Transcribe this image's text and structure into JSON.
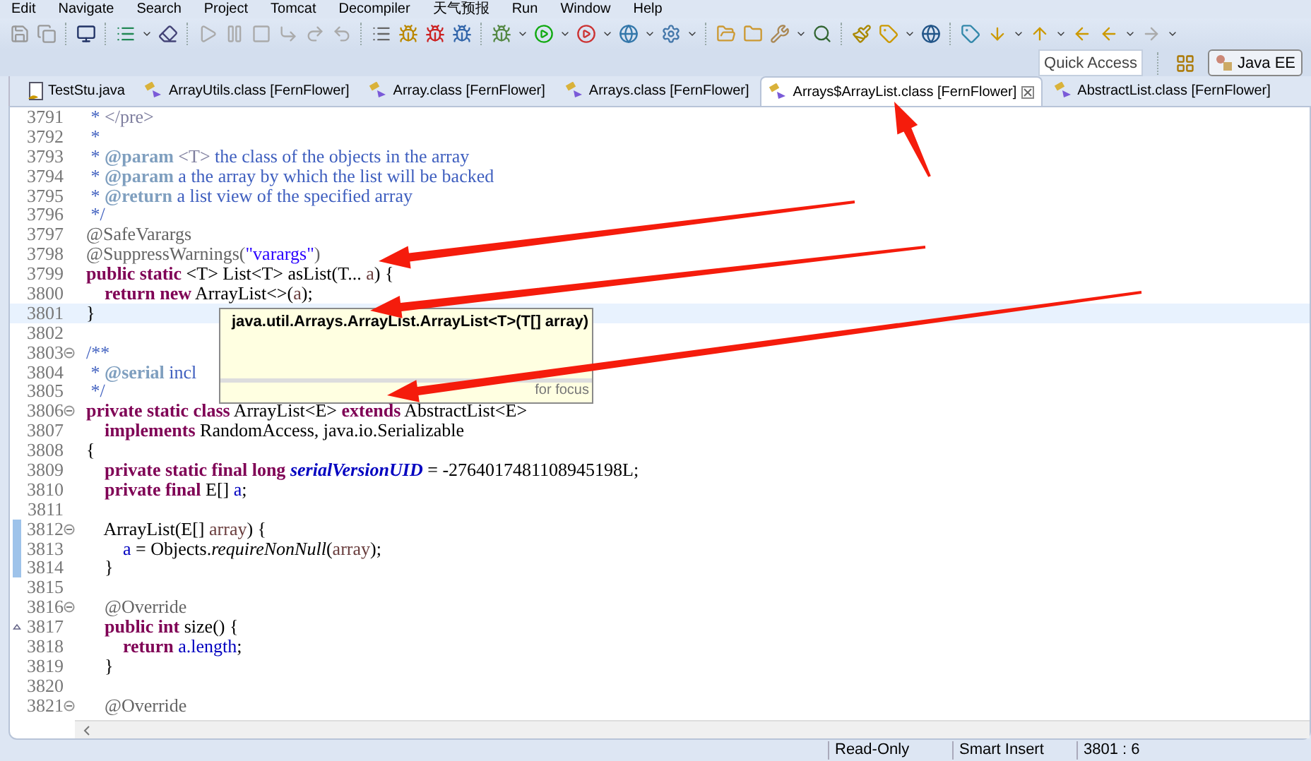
{
  "menu": [
    "Edit",
    "Navigate",
    "Search",
    "Project",
    "Tomcat",
    "Decompiler",
    "天气预报",
    "Run",
    "Window",
    "Help"
  ],
  "quick_access": {
    "placeholder": "Quick Access"
  },
  "perspective": {
    "label": "Java EE",
    "selected": true
  },
  "tabs": [
    {
      "label": "TestStu.java",
      "kind": "java",
      "selected": false
    },
    {
      "label": "ArrayUtils.class [FernFlower]",
      "kind": "class",
      "selected": false
    },
    {
      "label": "Array.class [FernFlower]",
      "kind": "class",
      "selected": false
    },
    {
      "label": "Arrays.class [FernFlower]",
      "kind": "class",
      "selected": false
    },
    {
      "label": "Arrays$ArrayList.class [FernFlower]",
      "kind": "class",
      "selected": true
    },
    {
      "label": "AbstractList.class [FernFlower]",
      "kind": "class",
      "selected": false
    }
  ],
  "lines": [
    {
      "number": "3791",
      "current": false,
      "foldable": false,
      "changed": false,
      "overrides": false,
      "segments": [
        {
          "kind": "comment",
          "text": " * "
        },
        {
          "kind": "html",
          "text": "</pre>"
        }
      ]
    },
    {
      "number": "3792",
      "current": false,
      "foldable": false,
      "changed": false,
      "overrides": false,
      "segments": [
        {
          "kind": "comment",
          "text": " *"
        }
      ]
    },
    {
      "number": "3793",
      "current": false,
      "foldable": false,
      "changed": false,
      "overrides": false,
      "segments": [
        {
          "kind": "comment",
          "text": " * "
        },
        {
          "kind": "doctag",
          "text": "@param"
        },
        {
          "kind": "html",
          "text": " <T>"
        },
        {
          "kind": "comment",
          "text": " the class of the objects in the array"
        }
      ]
    },
    {
      "number": "3794",
      "current": false,
      "foldable": false,
      "changed": false,
      "overrides": false,
      "segments": [
        {
          "kind": "comment",
          "text": " * "
        },
        {
          "kind": "doctag",
          "text": "@param"
        },
        {
          "kind": "comment",
          "text": " a the array by which the list will be backed"
        }
      ]
    },
    {
      "number": "3795",
      "current": false,
      "foldable": false,
      "changed": false,
      "overrides": false,
      "segments": [
        {
          "kind": "comment",
          "text": " * "
        },
        {
          "kind": "doctag",
          "text": "@return"
        },
        {
          "kind": "comment",
          "text": " a list view of the specified array"
        }
      ]
    },
    {
      "number": "3796",
      "current": false,
      "foldable": false,
      "changed": false,
      "overrides": false,
      "segments": [
        {
          "kind": "comment",
          "text": " */"
        }
      ]
    },
    {
      "number": "3797",
      "current": false,
      "foldable": false,
      "changed": false,
      "overrides": false,
      "segments": [
        {
          "kind": "annotation",
          "text": "@SafeVarargs"
        }
      ]
    },
    {
      "number": "3798",
      "current": false,
      "foldable": false,
      "changed": false,
      "overrides": false,
      "segments": [
        {
          "kind": "annotation",
          "text": "@SuppressWarnings("
        },
        {
          "kind": "string",
          "text": "\"varargs\""
        },
        {
          "kind": "annotation",
          "text": ")"
        }
      ]
    },
    {
      "number": "3799",
      "current": false,
      "foldable": false,
      "changed": false,
      "overrides": false,
      "segments": [
        {
          "kind": "keyword",
          "text": "public static"
        },
        {
          "kind": "plain",
          "text": " <T> List<T> asList(T... "
        },
        {
          "kind": "param",
          "text": "a"
        },
        {
          "kind": "plain",
          "text": ") {"
        }
      ]
    },
    {
      "number": "3800",
      "current": false,
      "foldable": false,
      "changed": false,
      "overrides": false,
      "segments": [
        {
          "kind": "keyword",
          "text": "    return new"
        },
        {
          "kind": "plain",
          "text": " ArrayList<>("
        },
        {
          "kind": "param",
          "text": "a"
        },
        {
          "kind": "plain",
          "text": ");"
        }
      ]
    },
    {
      "number": "3801",
      "current": true,
      "foldable": false,
      "changed": false,
      "overrides": false,
      "segments": [
        {
          "kind": "plain",
          "text": "}"
        }
      ]
    },
    {
      "number": "3802",
      "current": false,
      "foldable": false,
      "changed": false,
      "overrides": false
    },
    {
      "number": "3803",
      "current": false,
      "foldable": true,
      "changed": false,
      "overrides": false,
      "segments": [
        {
          "kind": "comment",
          "text": "/**"
        }
      ]
    },
    {
      "number": "3804",
      "current": false,
      "foldable": false,
      "changed": false,
      "overrides": false,
      "segments": [
        {
          "kind": "comment",
          "text": " * "
        },
        {
          "kind": "doctag",
          "text": "@serial"
        },
        {
          "kind": "comment",
          "text": " incl"
        }
      ]
    },
    {
      "number": "3805",
      "current": false,
      "foldable": false,
      "changed": false,
      "overrides": false,
      "segments": [
        {
          "kind": "comment",
          "text": " */"
        }
      ]
    },
    {
      "number": "3806",
      "current": false,
      "foldable": true,
      "changed": false,
      "overrides": false,
      "segments": [
        {
          "kind": "keyword",
          "text": "private static class"
        },
        {
          "kind": "plain",
          "text": " ArrayList<E> "
        },
        {
          "kind": "keyword",
          "text": "extends"
        },
        {
          "kind": "plain",
          "text": " AbstractList<E>"
        }
      ]
    },
    {
      "number": "3807",
      "current": false,
      "foldable": false,
      "changed": false,
      "overrides": false,
      "segments": [
        {
          "kind": "keyword",
          "text": "    implements"
        },
        {
          "kind": "plain",
          "text": " RandomAccess, java.io.Serializable"
        }
      ]
    },
    {
      "number": "3808",
      "current": false,
      "foldable": false,
      "changed": false,
      "overrides": false,
      "segments": [
        {
          "kind": "plain",
          "text": "{"
        }
      ]
    },
    {
      "number": "3809",
      "current": false,
      "foldable": false,
      "changed": false,
      "overrides": false,
      "segments": [
        {
          "kind": "keyword",
          "text": "    private static final long"
        },
        {
          "kind": "staticfield",
          "text": " serialVersionUID"
        },
        {
          "kind": "plain",
          "text": " = -2764017481108945198L;"
        }
      ]
    },
    {
      "number": "3810",
      "current": false,
      "foldable": false,
      "changed": false,
      "overrides": false,
      "segments": [
        {
          "kind": "keyword",
          "text": "    private final"
        },
        {
          "kind": "plain",
          "text": " E[] "
        },
        {
          "kind": "field",
          "text": "a"
        },
        {
          "kind": "plain",
          "text": ";"
        }
      ]
    },
    {
      "number": "3811",
      "current": false,
      "foldable": false,
      "changed": false,
      "overrides": false
    },
    {
      "number": "3812",
      "current": false,
      "foldable": true,
      "changed": true,
      "overrides": false,
      "segments": [
        {
          "kind": "plain",
          "text": "    ArrayList(E[] "
        },
        {
          "kind": "param",
          "text": "array"
        },
        {
          "kind": "plain",
          "text": ") {"
        }
      ]
    },
    {
      "number": "3813",
      "current": false,
      "foldable": false,
      "changed": true,
      "overrides": false,
      "segments": [
        {
          "kind": "field",
          "text": "        a"
        },
        {
          "kind": "plain",
          "text": " = Objects."
        },
        {
          "kind": "staticmethod",
          "text": "requireNonNull"
        },
        {
          "kind": "plain",
          "text": "("
        },
        {
          "kind": "param",
          "text": "array"
        },
        {
          "kind": "plain",
          "text": ");"
        }
      ]
    },
    {
      "number": "3814",
      "current": false,
      "foldable": false,
      "changed": true,
      "overrides": false,
      "segments": [
        {
          "kind": "plain",
          "text": "    }"
        }
      ]
    },
    {
      "number": "3815",
      "current": false,
      "foldable": false,
      "changed": false,
      "overrides": false
    },
    {
      "number": "3816",
      "current": false,
      "foldable": true,
      "changed": false,
      "overrides": false,
      "segments": [
        {
          "kind": "annotation",
          "text": "    @Override"
        }
      ]
    },
    {
      "number": "3817",
      "current": false,
      "foldable": false,
      "changed": false,
      "overrides": true,
      "segments": [
        {
          "kind": "keyword",
          "text": "    public int"
        },
        {
          "kind": "plain",
          "text": " size() {"
        }
      ]
    },
    {
      "number": "3818",
      "current": false,
      "foldable": false,
      "changed": false,
      "overrides": false,
      "segments": [
        {
          "kind": "keyword",
          "text": "        return"
        },
        {
          "kind": "field",
          "text": " a.length"
        },
        {
          "kind": "plain",
          "text": ";"
        }
      ]
    },
    {
      "number": "3819",
      "current": false,
      "foldable": false,
      "changed": false,
      "overrides": false,
      "segments": [
        {
          "kind": "plain",
          "text": "    }"
        }
      ]
    },
    {
      "number": "3820",
      "current": false,
      "foldable": false,
      "changed": false,
      "overrides": false
    },
    {
      "number": "3821",
      "current": false,
      "foldable": true,
      "changed": false,
      "overrides": false,
      "segments": [
        {
          "kind": "annotation",
          "text": "    @Override"
        }
      ]
    }
  ],
  "hover": {
    "signature": "java.util.Arrays.ArrayList.ArrayList<T>(T[] array)",
    "hint": "for focus"
  },
  "status_bar": [
    "Read-Only",
    "Smart Insert",
    "3801 : 6"
  ]
}
